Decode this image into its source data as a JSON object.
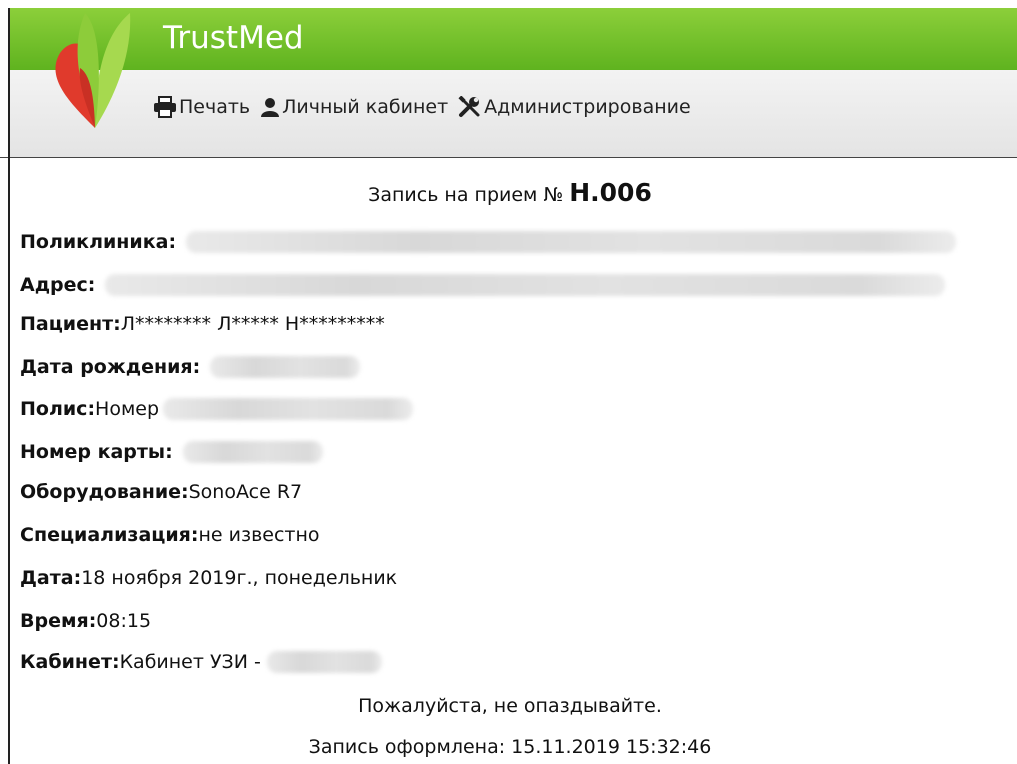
{
  "app": {
    "brand": "TrustMed"
  },
  "menu": [
    {
      "label": "Печать",
      "icon": "printer-icon"
    },
    {
      "label": "Личный кабинет",
      "icon": "user-icon"
    },
    {
      "label": "Администрирование",
      "icon": "tools-icon"
    }
  ],
  "ticket": {
    "title_prefix": "Запись на прием № ",
    "number": "Н.006",
    "fields": {
      "clinic": {
        "label": "Поликлиника:"
      },
      "address": {
        "label": "Адрес:"
      },
      "patient": {
        "label": "Пациент:",
        "value": " Л******** Л***** Н*********"
      },
      "birthdate": {
        "label": "Дата рождения:"
      },
      "policy": {
        "label": "Полис:",
        "value": " Номер"
      },
      "card": {
        "label": "Номер карты:"
      },
      "equipment": {
        "label": "Оборудование:",
        "value": " SonoAce R7"
      },
      "specialization": {
        "label": "Специализация:",
        "value": " не известно"
      },
      "date": {
        "label": "Дата:",
        "value": " 18 ноября 2019г., понедельник"
      },
      "time": {
        "label": "Время:",
        "value": " 08:15"
      },
      "room": {
        "label": "Кабинет:",
        "value": " Кабинет УЗИ -"
      }
    },
    "reminder": "Пожалуйста, не опаздывайте.",
    "issued": "Запись оформлена: 15.11.2019 15:32:46"
  },
  "colors": {
    "header_green": "#6cbf27",
    "logo_red": "#e03a2c",
    "logo_green": "#9fd64a"
  }
}
